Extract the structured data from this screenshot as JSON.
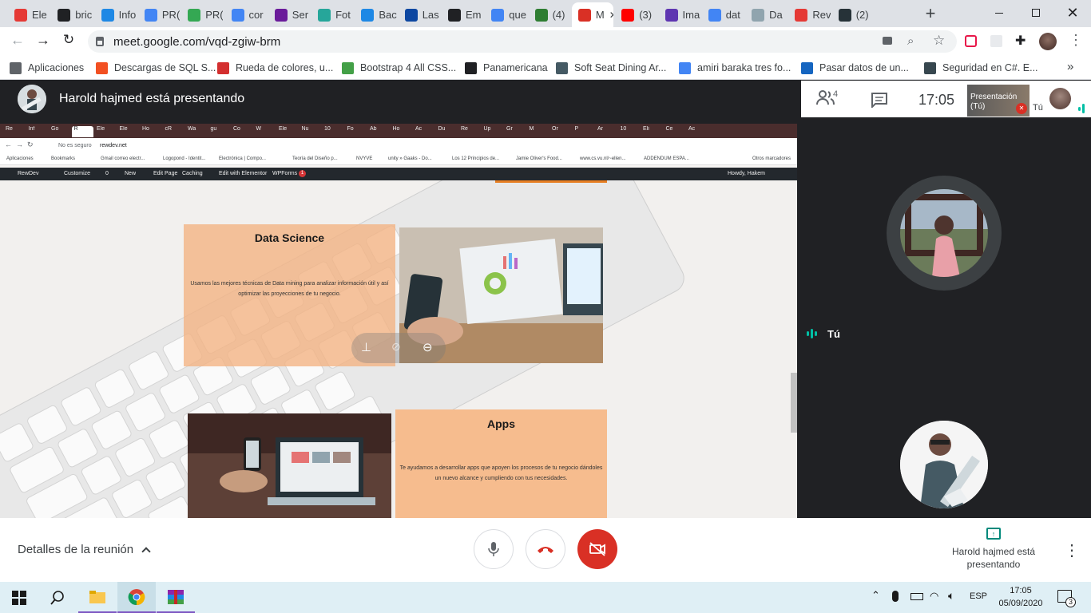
{
  "browser": {
    "tabs": [
      {
        "label": "Ele",
        "color": "#e53935"
      },
      {
        "label": "bric",
        "color": "#202124"
      },
      {
        "label": "Info",
        "color": "#1e88e5"
      },
      {
        "label": "PR(",
        "color": "#4285f4"
      },
      {
        "label": "PR(",
        "color": "#34a853"
      },
      {
        "label": "cor",
        "color": "#4285f4"
      },
      {
        "label": "Ser",
        "color": "#6a1b9a"
      },
      {
        "label": "Fot",
        "color": "#26a69a"
      },
      {
        "label": "Bac",
        "color": "#1e88e5"
      },
      {
        "label": "Las",
        "color": "#0d47a1"
      },
      {
        "label": "Em",
        "color": "#202124"
      },
      {
        "label": "que",
        "color": "#4285f4"
      },
      {
        "label": "(4)",
        "color": "#2e7d32"
      },
      {
        "label": "M",
        "color": "#d93025",
        "active": true
      },
      {
        "label": "(3)",
        "color": "#ff0000"
      },
      {
        "label": "Ima",
        "color": "#5e35b1"
      },
      {
        "label": "dat",
        "color": "#4285f4"
      },
      {
        "label": "Da",
        "color": "#90a4ae"
      },
      {
        "label": "Rev",
        "color": "#e53935"
      },
      {
        "label": "(2)",
        "color": "#263238"
      }
    ],
    "new_tab": "+",
    "url": "meet.google.com/vqd-zgiw-brm",
    "bookmarks": [
      {
        "label": "Aplicaciones",
        "color": "#5f6368"
      },
      {
        "label": "Descargas de SQL S...",
        "color": "#f25022"
      },
      {
        "label": "Rueda de colores, u...",
        "color": "#d32f2f"
      },
      {
        "label": "Bootstrap 4 All CSS...",
        "color": "#43a047"
      },
      {
        "label": "Panamericana",
        "color": "#202124"
      },
      {
        "label": "Soft Seat Dining Ar...",
        "color": "#455a64"
      },
      {
        "label": "amiri baraka tres fo...",
        "color": "#4285f4"
      },
      {
        "label": "Pasar datos de un...",
        "color": "#1565c0"
      },
      {
        "label": "Seguridad en C#. E...",
        "color": "#37474f"
      }
    ],
    "more_bookmarks": "»"
  },
  "meet": {
    "presenter_banner": "Harold hajmed está presentando",
    "participants_count": "4",
    "clock": "17:05",
    "self_tile_label": "Presentación (Tú)",
    "self_short": "Tú",
    "right_self_label": "Tú",
    "meeting_details": "Detalles de la reunión",
    "presenting_status": "Harold hajmed está presentando"
  },
  "shared_screen": {
    "tabs": [
      "Re",
      "Inf",
      "Go",
      "R",
      "Ele",
      "Ele",
      "Ho",
      "cR",
      "Wa",
      "gu",
      "Co",
      "W",
      "Ele",
      "Nu",
      "10",
      "Fo",
      "Ab",
      "Ho",
      "Ac",
      "Du",
      "Re",
      "Up",
      "Gr",
      "M",
      "Or",
      "P",
      "Ar",
      "10",
      "Eli",
      "Ce",
      "Ac"
    ],
    "security": "No es seguro",
    "url": "rewdev.net",
    "bookmarks": [
      "Aplicaciones",
      "Bookmarks",
      "Gmail correo electr...",
      "Logopond - Identit...",
      "Electrónica | Compo...",
      "Teoría del Diseño p...",
      "NVYVE",
      "unity » Gaaks - Do...",
      "Los 12 Principios de...",
      "Jamie Oliver's Food...",
      "www.cs.vu.nl/~ellen...",
      "ADDENDUM ESPA..."
    ],
    "other_bookmarks": "Otros marcadores",
    "wp_bar": [
      "RewDev",
      "Customize",
      "0",
      "New",
      "Edit Page",
      "Caching",
      "Edit with Elementor",
      "WPForms"
    ],
    "wp_forms_badge": "1",
    "wp_howdy": "Howdy, Hakem",
    "card1_title": "Data Science",
    "card1_text": "Usamos las mejores técnicas de Data mining para analizar información útil y así optimizar las proyecciones de tu negocio.",
    "card2_title": "Apps",
    "card2_text": "Te ayudamos a desarrollar apps que apoyen los procesos de tu negocio dándoles un nuevo alcance y cumpliendo con tus necesidades."
  },
  "taskbar": {
    "language": "ESP",
    "time": "17:05",
    "date": "05/09/2020",
    "notifications": "3"
  }
}
